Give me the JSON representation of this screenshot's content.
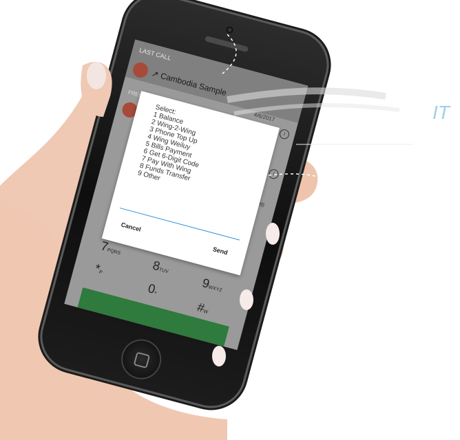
{
  "screen": {
    "last_call_label": "LAST CALL",
    "contact_name": "↗ Cambodia Sample",
    "frequent_label": "FREQ",
    "date": "4/6/2017",
    "dialog": {
      "items": [
        "Select:",
        "1 Balance",
        "2 Wing-2-Wing",
        "3 Phone Top Up",
        "4 Wing Weiluy",
        "5 Bills Payment",
        "6 Get 6-Digit Code",
        "7 Pay With Wing",
        "8 Funds Transfer",
        "9 Other"
      ],
      "cancel_label": "Cancel",
      "send_label": "Send"
    },
    "dialpad": {
      "key7": "7",
      "key7_sub": "PQRS",
      "key8": "8",
      "key8_sub": "TUV",
      "key9": "9",
      "key9_sub": "WXYZ",
      "keystar": "*",
      "keystar_sub": "P",
      "key0": "0",
      "key0_sub": "+",
      "keyhash": "#",
      "keyhash_sub": "W"
    },
    "side_labels": [
      "MB"
    ]
  },
  "overlay_text": "IT",
  "colors": {
    "dialog_line": "#2a8fd6",
    "call_bar": "#2f7a3d",
    "avatar": "#a84a3a"
  }
}
